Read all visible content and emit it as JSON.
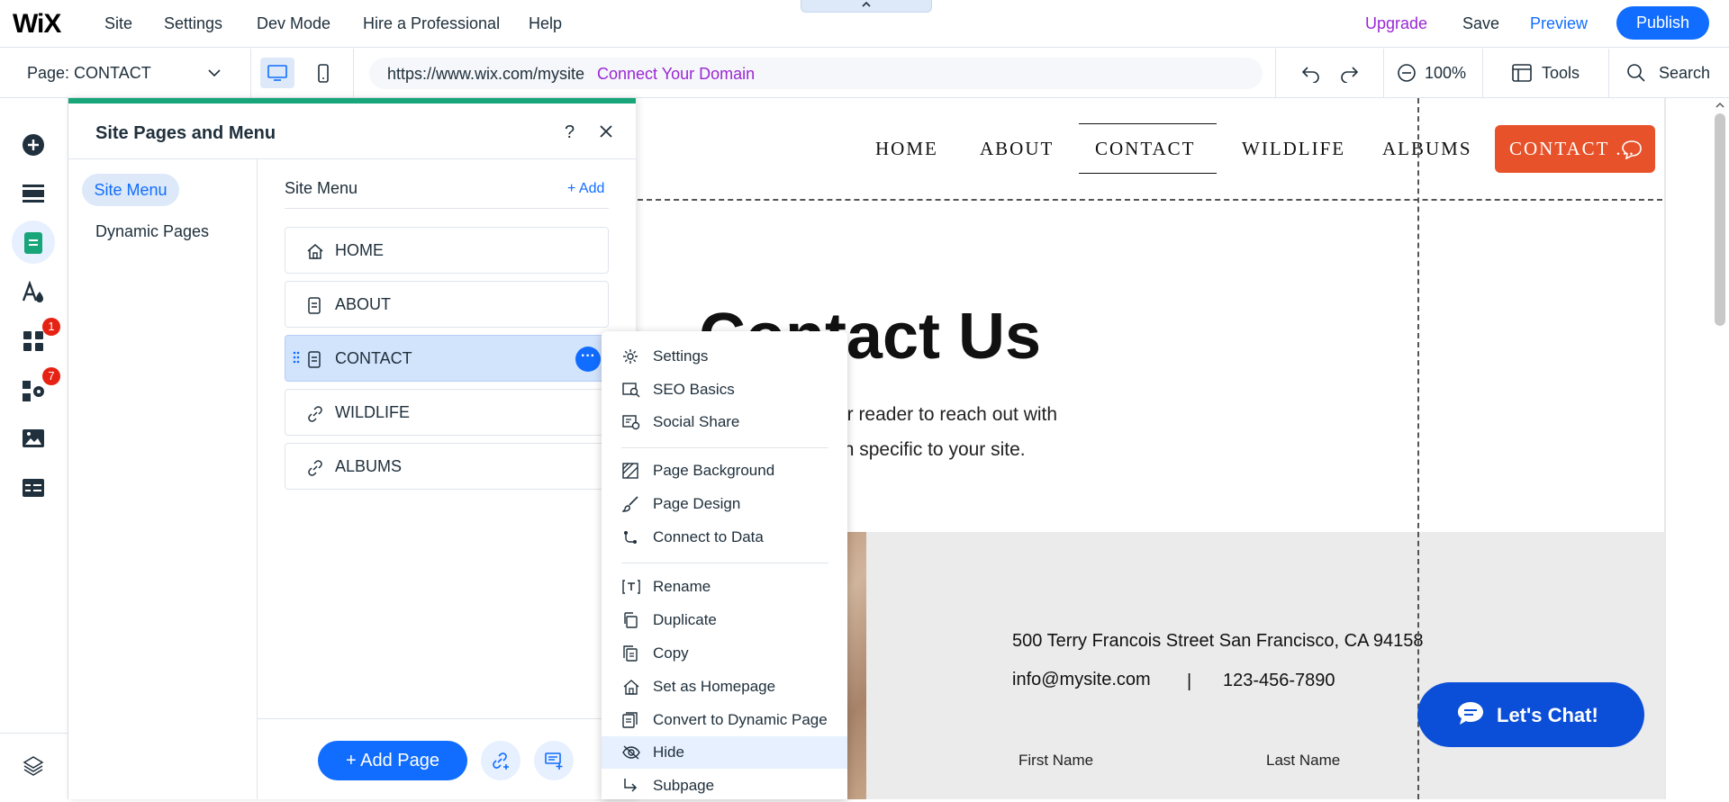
{
  "topbar": {
    "logo": "WiX",
    "menu": [
      "Site",
      "Settings",
      "Dev Mode",
      "Hire a Professional",
      "Help"
    ],
    "upgrade": "Upgrade",
    "save": "Save",
    "preview": "Preview",
    "publish": "Publish"
  },
  "toolbar": {
    "page_select": "Page: CONTACT",
    "url": "https://www.wix.com/mysite",
    "connect_domain": "Connect Your Domain",
    "zoom": "100%",
    "tools": "Tools",
    "search": "Search"
  },
  "rail": {
    "badges": [
      "1",
      "7"
    ]
  },
  "panel": {
    "title": "Site Pages and Menu",
    "help": "?",
    "tabs": [
      "Site Menu",
      "Dynamic Pages"
    ],
    "site_menu_header": "Site Menu",
    "add": "+ Add",
    "pages": [
      {
        "label": "HOME",
        "icon": "home-icon"
      },
      {
        "label": "ABOUT",
        "icon": "page-icon"
      },
      {
        "label": "CONTACT",
        "icon": "page-icon",
        "selected": true
      },
      {
        "label": "WILDLIFE",
        "icon": "link-icon"
      },
      {
        "label": "ALBUMS",
        "icon": "link-icon"
      }
    ],
    "more": "···",
    "add_page": "+ Add Page"
  },
  "context_menu": {
    "items": [
      "Settings",
      "SEO Basics",
      "Social Share",
      "Page Background",
      "Page Design",
      "Connect to Data",
      "Rename",
      "Duplicate",
      "Copy",
      "Set as Homepage",
      "Convert to Dynamic Page",
      "Hide",
      "Subpage"
    ],
    "highlighted": "Hide"
  },
  "site": {
    "nav": [
      "HOME",
      "ABOUT",
      "CONTACT",
      "WILDLIFE",
      "ALBUMS"
    ],
    "active_nav": "CONTACT",
    "contact_button": "CONTACT ...",
    "title": "Contact Us",
    "body_line1": "n. Encourage your reader to reach out with",
    "body_line2": "e a different action specific to your site.",
    "address": "500 Terry Francois Street San Francisco, CA 94158",
    "email": "info@mysite.com",
    "separator": "|",
    "phone": "123-456-7890",
    "first_name": "First Name",
    "last_name": "Last Name",
    "chat": "Let's Chat!"
  },
  "colors": {
    "accent": "#116dff",
    "panel_accent": "#17a579",
    "contact_button": "#e8522a",
    "upgrade": "#9a27d5",
    "chat": "#0b4fd8"
  }
}
